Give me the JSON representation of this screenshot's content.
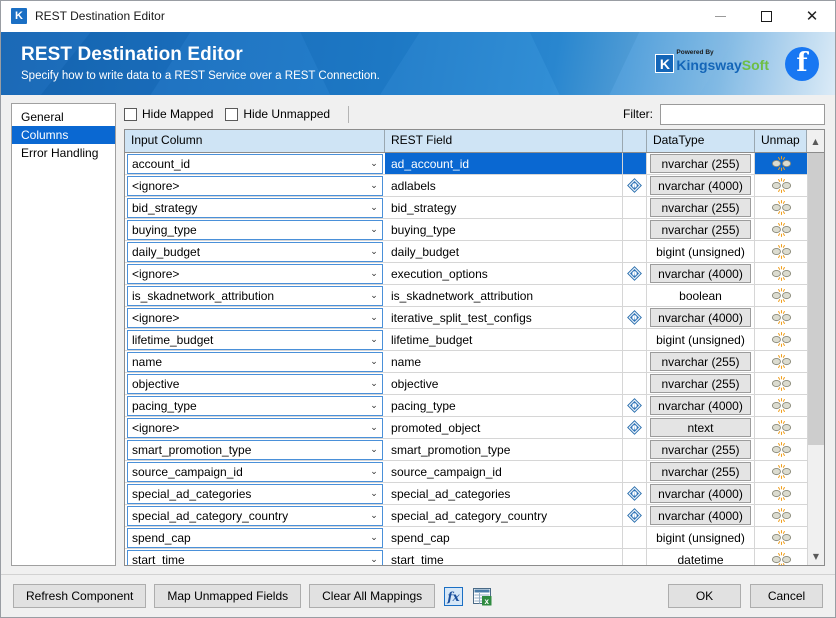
{
  "window": {
    "title": "REST Destination Editor",
    "app_icon": "kingswaysoft-k-icon",
    "controls": {
      "minimize": "minimize-icon",
      "maximize": "maximize-icon",
      "close": "close-icon"
    }
  },
  "banner": {
    "title": "REST Destination Editor",
    "subtitle": "Specify how to write data to a REST Service over a REST Connection.",
    "logo": {
      "powered_by": "Powered By",
      "kingsway": "Kingsway",
      "soft": "Soft",
      "k": "K"
    },
    "facebook_icon": "facebook-icon",
    "facebook_glyph": "f"
  },
  "sidebar": {
    "items": [
      {
        "label": "General",
        "selected": false
      },
      {
        "label": "Columns",
        "selected": true
      },
      {
        "label": "Error Handling",
        "selected": false
      }
    ]
  },
  "toolbar": {
    "hide_mapped_label": "Hide Mapped",
    "hide_mapped_checked": false,
    "hide_unmapped_label": "Hide Unmapped",
    "hide_unmapped_checked": false,
    "filter_label": "Filter:",
    "filter_value": "",
    "filter_placeholder": ""
  },
  "grid": {
    "columns": [
      {
        "key": "input_column",
        "label": "Input Column"
      },
      {
        "key": "rest_field",
        "label": "REST Field"
      },
      {
        "key": "flag",
        "label": ""
      },
      {
        "key": "datatype",
        "label": "DataType"
      },
      {
        "key": "unmap",
        "label": "Unmap"
      }
    ],
    "selected_row_index": 0,
    "scrollbar": {
      "up": "chevron-up-icon",
      "down": "chevron-down-icon",
      "thumb_height_pct": 74
    },
    "rows": [
      {
        "input_column": "account_id",
        "rest_field": "ad_account_id",
        "flag": false,
        "datatype": "nvarchar (255)",
        "datatype_button": true,
        "unmap": "unmap-icon"
      },
      {
        "input_column": "<ignore>",
        "rest_field": "adlabels",
        "flag": true,
        "datatype": "nvarchar (4000)",
        "datatype_button": true,
        "unmap": "unmap-icon"
      },
      {
        "input_column": "bid_strategy",
        "rest_field": "bid_strategy",
        "flag": false,
        "datatype": "nvarchar (255)",
        "datatype_button": true,
        "unmap": "unmap-icon"
      },
      {
        "input_column": "buying_type",
        "rest_field": "buying_type",
        "flag": false,
        "datatype": "nvarchar (255)",
        "datatype_button": true,
        "unmap": "unmap-icon"
      },
      {
        "input_column": "daily_budget",
        "rest_field": "daily_budget",
        "flag": false,
        "datatype": "bigint (unsigned)",
        "datatype_button": false,
        "unmap": "unmap-icon"
      },
      {
        "input_column": "<ignore>",
        "rest_field": "execution_options",
        "flag": true,
        "datatype": "nvarchar (4000)",
        "datatype_button": true,
        "unmap": "unmap-icon"
      },
      {
        "input_column": "is_skadnetwork_attribution",
        "rest_field": "is_skadnetwork_attribution",
        "flag": false,
        "datatype": "boolean",
        "datatype_button": false,
        "unmap": "unmap-icon"
      },
      {
        "input_column": "<ignore>",
        "rest_field": "iterative_split_test_configs",
        "flag": true,
        "datatype": "nvarchar (4000)",
        "datatype_button": true,
        "unmap": "unmap-icon"
      },
      {
        "input_column": "lifetime_budget",
        "rest_field": "lifetime_budget",
        "flag": false,
        "datatype": "bigint (unsigned)",
        "datatype_button": false,
        "unmap": "unmap-icon"
      },
      {
        "input_column": "name",
        "rest_field": "name",
        "flag": false,
        "datatype": "nvarchar (255)",
        "datatype_button": true,
        "unmap": "unmap-icon"
      },
      {
        "input_column": "objective",
        "rest_field": "objective",
        "flag": false,
        "datatype": "nvarchar (255)",
        "datatype_button": true,
        "unmap": "unmap-icon"
      },
      {
        "input_column": "pacing_type",
        "rest_field": "pacing_type",
        "flag": true,
        "datatype": "nvarchar (4000)",
        "datatype_button": true,
        "unmap": "unmap-icon"
      },
      {
        "input_column": "<ignore>",
        "rest_field": "promoted_object",
        "flag": true,
        "datatype": "ntext",
        "datatype_button": true,
        "unmap": "unmap-icon"
      },
      {
        "input_column": "smart_promotion_type",
        "rest_field": "smart_promotion_type",
        "flag": false,
        "datatype": "nvarchar (255)",
        "datatype_button": true,
        "unmap": "unmap-icon"
      },
      {
        "input_column": "source_campaign_id",
        "rest_field": "source_campaign_id",
        "flag": false,
        "datatype": "nvarchar (255)",
        "datatype_button": true,
        "unmap": "unmap-icon"
      },
      {
        "input_column": "special_ad_categories",
        "rest_field": "special_ad_categories",
        "flag": true,
        "datatype": "nvarchar (4000)",
        "datatype_button": true,
        "unmap": "unmap-icon"
      },
      {
        "input_column": "special_ad_category_country",
        "rest_field": "special_ad_category_country",
        "flag": true,
        "datatype": "nvarchar (4000)",
        "datatype_button": true,
        "unmap": "unmap-icon"
      },
      {
        "input_column": "spend_cap",
        "rest_field": "spend_cap",
        "flag": false,
        "datatype": "bigint (unsigned)",
        "datatype_button": false,
        "unmap": "unmap-icon"
      },
      {
        "input_column": "start_time",
        "rest_field": "start_time",
        "flag": false,
        "datatype": "datetime",
        "datatype_button": false,
        "unmap": "unmap-icon"
      }
    ]
  },
  "footer": {
    "refresh_label": "Refresh Component",
    "map_unmapped_label": "Map Unmapped Fields",
    "clear_all_label": "Clear All Mappings",
    "fx_icon": "fx-icon",
    "fx_text": "fx",
    "export_icon": "export-spreadsheet-icon",
    "ok_label": "OK",
    "cancel_label": "Cancel"
  },
  "colors": {
    "accent": "#0a68d2",
    "banner_blue": "#1a70c0",
    "header_blue": "#cfe4f5",
    "facebook": "#1877f2",
    "kingsway_blue": "#1466b8",
    "kingsway_green": "#6ebe45"
  }
}
